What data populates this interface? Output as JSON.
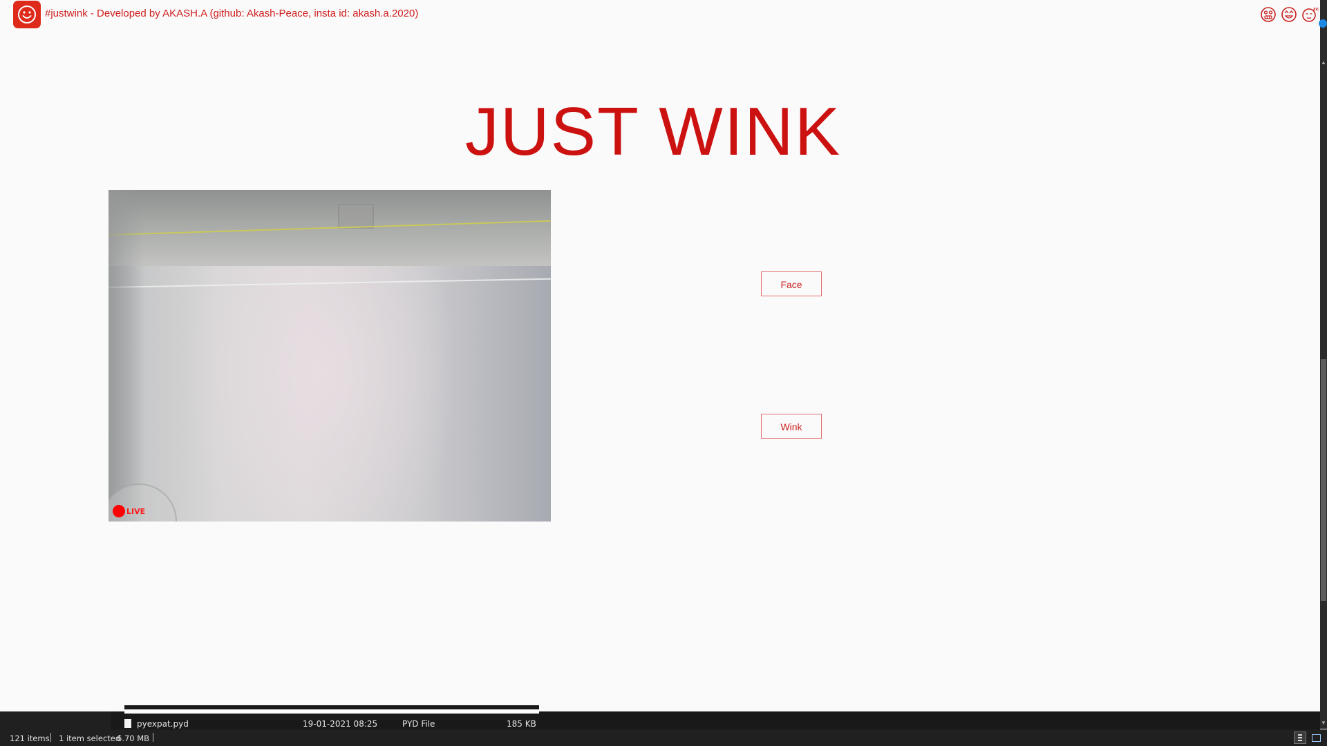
{
  "window": {
    "title": "#justwink - Developed by AKASH.A (github: Akash-Peace, insta id: akash.a.2020)",
    "title_icons": [
      "grimace-emoji-icon",
      "star-eyes-emoji-icon",
      "sleepy-emoji-icon"
    ]
  },
  "main": {
    "heading": "JUST WINK",
    "camera": {
      "live_label": "LIVE"
    },
    "buttons": {
      "face": "Face",
      "wink": "Wink"
    }
  },
  "explorer": {
    "file": {
      "name": "pyexpat.pyd",
      "date": "19-01-2021 08:25",
      "type": "PYD File",
      "size": "185 KB"
    }
  },
  "statusbar": {
    "items_count": "121 items",
    "selection": "1 item selected",
    "selection_size": "6.70 MB"
  },
  "colors": {
    "accent": "#cc1111",
    "button_border": "#e36d6d",
    "live": "#ff0000",
    "background": "#fafafa"
  }
}
